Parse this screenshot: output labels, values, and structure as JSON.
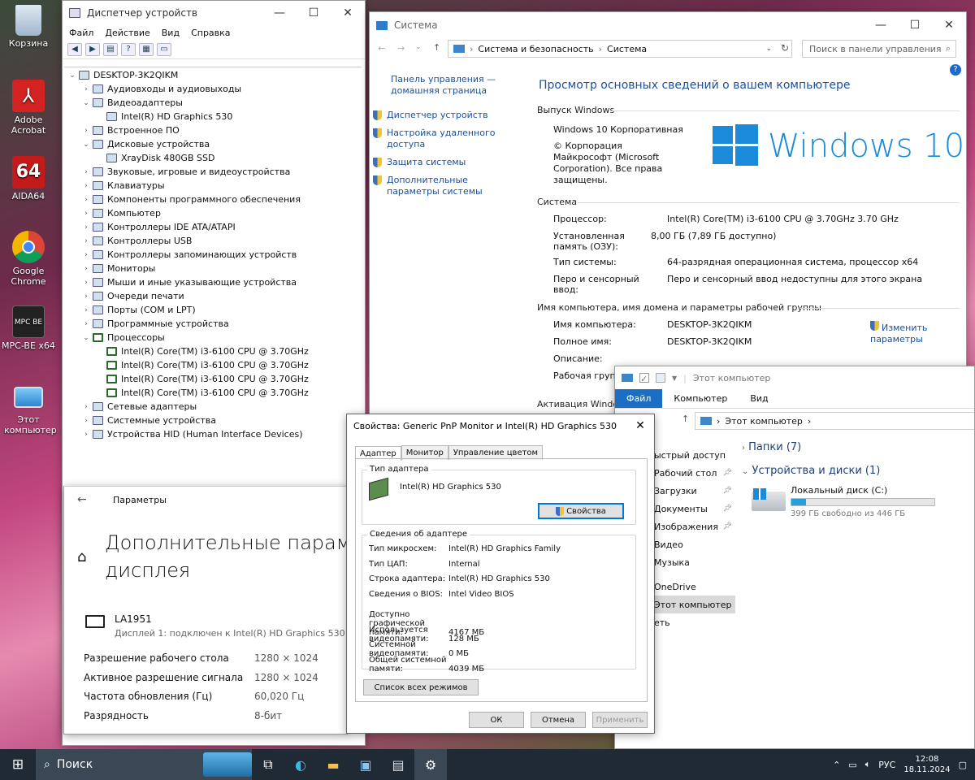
{
  "desktop": {
    "icons": [
      {
        "label": "Корзина"
      },
      {
        "label": "Adobe Acrobat"
      },
      {
        "label": "AIDA64"
      },
      {
        "label": "Google Chrome"
      },
      {
        "label": "MPC-BE x64"
      },
      {
        "label": "Этот компьютер"
      }
    ]
  },
  "devmgr": {
    "title": "Диспетчер устройств",
    "menu": [
      "Файл",
      "Действие",
      "Вид",
      "Справка"
    ],
    "tree": [
      {
        "lvl": 0,
        "exp": "v",
        "text": "DESKTOP-3K2QIKM",
        "icon": "computer"
      },
      {
        "lvl": 1,
        "exp": ">",
        "text": "Аудиовходы и аудиовыходы"
      },
      {
        "lvl": 1,
        "exp": "v",
        "text": "Видеоадаптеры"
      },
      {
        "lvl": 2,
        "exp": "",
        "text": "Intel(R) HD Graphics 530"
      },
      {
        "lvl": 1,
        "exp": ">",
        "text": "Встроенное ПО"
      },
      {
        "lvl": 1,
        "exp": "v",
        "text": "Дисковые устройства"
      },
      {
        "lvl": 2,
        "exp": "",
        "text": "XrayDisk 480GB SSD"
      },
      {
        "lvl": 1,
        "exp": ">",
        "text": "Звуковые, игровые и видеоустройства"
      },
      {
        "lvl": 1,
        "exp": ">",
        "text": "Клавиатуры"
      },
      {
        "lvl": 1,
        "exp": ">",
        "text": "Компоненты программного обеспечения"
      },
      {
        "lvl": 1,
        "exp": ">",
        "text": "Компьютер"
      },
      {
        "lvl": 1,
        "exp": ">",
        "text": "Контроллеры IDE ATA/ATAPI"
      },
      {
        "lvl": 1,
        "exp": ">",
        "text": "Контроллеры USB"
      },
      {
        "lvl": 1,
        "exp": ">",
        "text": "Контроллеры запоминающих устройств"
      },
      {
        "lvl": 1,
        "exp": ">",
        "text": "Мониторы"
      },
      {
        "lvl": 1,
        "exp": ">",
        "text": "Мыши и иные указывающие устройства"
      },
      {
        "lvl": 1,
        "exp": ">",
        "text": "Очереди печати"
      },
      {
        "lvl": 1,
        "exp": ">",
        "text": "Порты (COM и LPT)"
      },
      {
        "lvl": 1,
        "exp": ">",
        "text": "Программные устройства"
      },
      {
        "lvl": 1,
        "exp": "v",
        "text": "Процессоры",
        "icon": "cpu"
      },
      {
        "lvl": 2,
        "exp": "",
        "text": "Intel(R) Core(TM) i3-6100 CPU @ 3.70GHz",
        "icon": "cpu"
      },
      {
        "lvl": 2,
        "exp": "",
        "text": "Intel(R) Core(TM) i3-6100 CPU @ 3.70GHz",
        "icon": "cpu"
      },
      {
        "lvl": 2,
        "exp": "",
        "text": "Intel(R) Core(TM) i3-6100 CPU @ 3.70GHz",
        "icon": "cpu"
      },
      {
        "lvl": 2,
        "exp": "",
        "text": "Intel(R) Core(TM) i3-6100 CPU @ 3.70GHz",
        "icon": "cpu"
      },
      {
        "lvl": 1,
        "exp": ">",
        "text": "Сетевые адаптеры"
      },
      {
        "lvl": 1,
        "exp": ">",
        "text": "Системные устройства"
      },
      {
        "lvl": 1,
        "exp": ">",
        "text": "Устройства HID (Human Interface Devices)"
      }
    ]
  },
  "settings": {
    "title": "Параметры",
    "heading1": "Дополнительные парамет",
    "heading2": "дисплея",
    "monitor": "LA1951",
    "monitor_sub": "Дисплей 1: подключен к Intel(R) HD Graphics 530",
    "rows": [
      {
        "k": "Разрешение рабочего стола",
        "v": "1280 × 1024"
      },
      {
        "k": "Активное разрешение сигнала",
        "v": "1280 × 1024"
      },
      {
        "k": "Частота обновления (Гц)",
        "v": "60,020 Гц"
      },
      {
        "k": "Разрядность",
        "v": "8-бит"
      }
    ]
  },
  "system": {
    "title": "Система",
    "breadcrumb": [
      "Система и безопасность",
      "Система"
    ],
    "search_placeholder": "Поиск в панели управления",
    "side_home": "Панель управления — домашняя страница",
    "side_links": [
      "Диспетчер устройств",
      "Настройка удаленного доступа",
      "Защита системы",
      "Дополнительные параметры системы"
    ],
    "heading": "Просмотр основных сведений о вашем компьютере",
    "edition_h": "Выпуск Windows",
    "edition": "Windows 10 Корпоративная",
    "copyright": "© Корпорация Майкрософт (Microsoft Corporation). Все права защищены.",
    "logo_text": "Windows 10",
    "system_h": "Система",
    "sys_rows": [
      {
        "k": "Процессор:",
        "v": "Intel(R) Core(TM) i3-6100 CPU @ 3.70GHz   3.70 GHz"
      },
      {
        "k": "Установленная память (ОЗУ):",
        "v": "8,00 ГБ (7,89 ГБ доступно)"
      },
      {
        "k": "Тип системы:",
        "v": "64-разрядная операционная система, процессор x64"
      },
      {
        "k": "Перо и сенсорный ввод:",
        "v": "Перо и сенсорный ввод недоступны для этого экрана"
      }
    ],
    "name_h": "Имя компьютера, имя домена и параметры рабочей группы",
    "name_rows": [
      {
        "k": "Имя компьютера:",
        "v": "DESKTOP-3K2QIKM"
      },
      {
        "k": "Полное имя:",
        "v": "DESKTOP-3K2QIKM"
      },
      {
        "k": "Описание:",
        "v": ""
      },
      {
        "k": "Рабочая групп",
        "v": ""
      }
    ],
    "change_link": "Изменить параметры",
    "activation_h": "Активация Window"
  },
  "dialog": {
    "title": "Свойства: Generic PnP Monitor и Intel(R) HD Graphics 530",
    "tabs": [
      "Адаптер",
      "Монитор",
      "Управление цветом"
    ],
    "type_grp": "Тип адаптера",
    "adapter_name": "Intel(R) HD Graphics 530",
    "props_btn": "Свойства",
    "info_grp": "Сведения об адаптере",
    "info": [
      {
        "k": "Тип микросхем:",
        "v": "Intel(R) HD Graphics Family"
      },
      {
        "k": "Тип ЦАП:",
        "v": "Internal"
      },
      {
        "k": "Строка адаптера:",
        "v": "Intel(R) HD Graphics 530"
      },
      {
        "k": "Сведения о BIOS:",
        "v": "Intel Video BIOS"
      }
    ],
    "mem": [
      {
        "k": "Доступно графической памяти:",
        "v": "4167 МБ"
      },
      {
        "k": "Используется видеопамяти:",
        "v": "128 МБ"
      },
      {
        "k": "Системной видеопамяти:",
        "v": "0 МБ"
      },
      {
        "k": "Общей системной памяти:",
        "v": "4039 МБ"
      }
    ],
    "modes_btn": "Список всех режимов",
    "ok": "ОК",
    "cancel": "Отмена",
    "apply": "Применить"
  },
  "explorer": {
    "title": "Этот компьютер",
    "ribbon": [
      "Файл",
      "Компьютер",
      "Вид"
    ],
    "address": "Этот компьютер",
    "nav": [
      "ыстрый доступ",
      "Рабочий стол",
      "Загрузки",
      "Документы",
      "Изображения",
      "Видео",
      "Музыка",
      "OneDrive",
      "Этот компьютер",
      "еть"
    ],
    "folders_h": "Папки (7)",
    "drives_h": "Устройства и диски (1)",
    "drive_name": "Локальный диск (C:)",
    "drive_free": "399 ГБ свободно из 446 ГБ",
    "drive_used_fraction": 0.105
  },
  "taskbar": {
    "search": "Поиск",
    "lang": "РУС",
    "time": "12:08",
    "date": "18.11.2024"
  }
}
